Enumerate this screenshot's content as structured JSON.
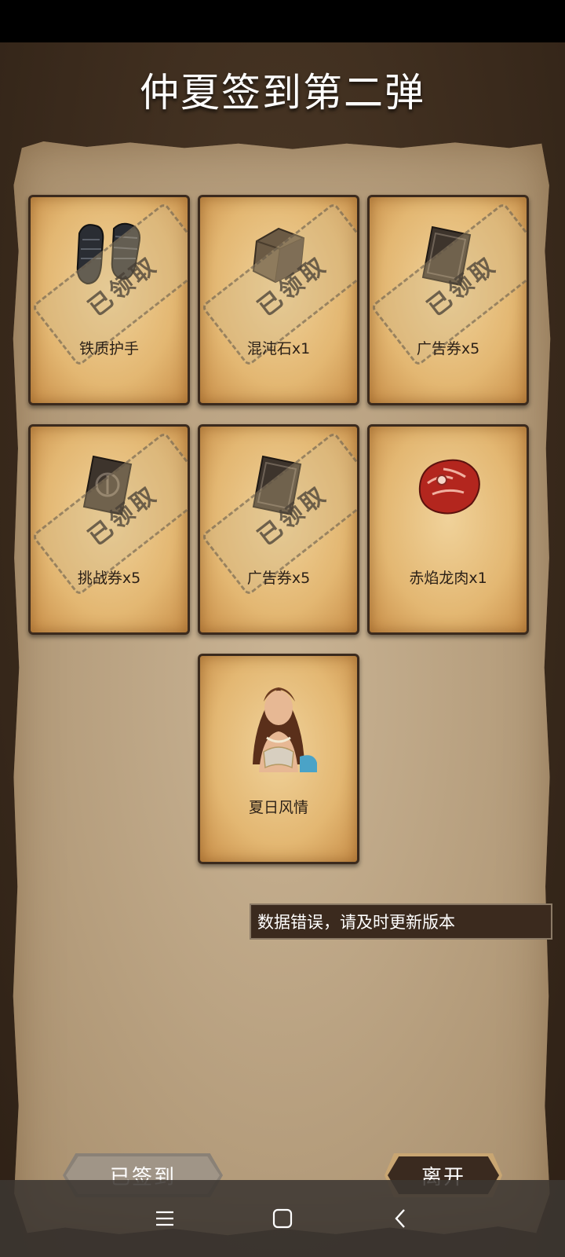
{
  "title": "仲夏签到第二弹",
  "claimed_stamp": "已领取",
  "cards": [
    {
      "label": "铁质护手",
      "icon": "gauntlet-icon",
      "claimed": true
    },
    {
      "label": "混沌石x1",
      "icon": "stone-icon",
      "claimed": true
    },
    {
      "label": "广告券x5",
      "icon": "ad-ticket-icon",
      "claimed": true
    },
    {
      "label": "挑战券x5",
      "icon": "challenge-ticket-icon",
      "claimed": true
    },
    {
      "label": "广告券x5",
      "icon": "ad-ticket-icon",
      "claimed": true
    },
    {
      "label": "赤焰龙肉x1",
      "icon": "dragon-meat-icon",
      "claimed": false
    },
    {
      "label": "夏日风情",
      "icon": "character-portrait-icon",
      "claimed": false
    }
  ],
  "toast": "数据错误，请及时更新版本",
  "buttons": {
    "signed": "已签到",
    "leave": "离开"
  },
  "navbar": {
    "menu_icon": "menu-icon",
    "home_icon": "home-icon",
    "back_icon": "back-icon"
  }
}
